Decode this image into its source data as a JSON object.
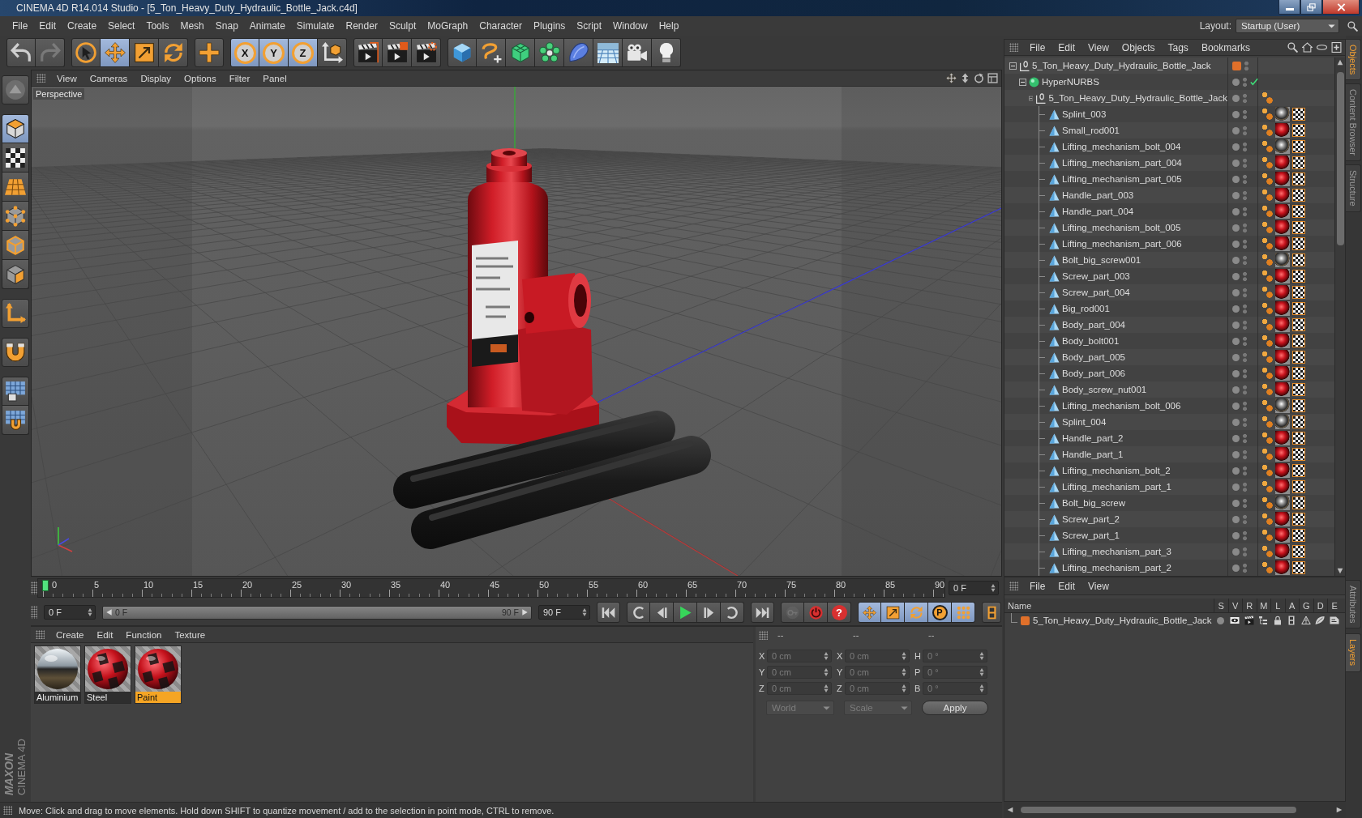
{
  "window": {
    "title": "CINEMA 4D R14.014 Studio - [5_Ton_Heavy_Duty_Hydraulic_Bottle_Jack.c4d]"
  },
  "menu": [
    "File",
    "Edit",
    "Create",
    "Select",
    "Tools",
    "Mesh",
    "Snap",
    "Animate",
    "Simulate",
    "Render",
    "Sculpt",
    "MoGraph",
    "Character",
    "Plugins",
    "Script",
    "Window",
    "Help"
  ],
  "layout": {
    "label": "Layout:",
    "value": "Startup (User)"
  },
  "toolbar": [
    {
      "tools": [
        {
          "kind": "undo",
          "disabled": false
        },
        {
          "kind": "redo",
          "disabled": true
        }
      ]
    },
    {
      "tools": [
        {
          "kind": "select",
          "selected": false
        },
        {
          "kind": "move",
          "selected": true
        },
        {
          "kind": "scale",
          "selected": false
        },
        {
          "kind": "rotate",
          "selected": false
        }
      ]
    },
    {
      "tools": [
        {
          "kind": "add",
          "selected": false
        }
      ]
    },
    {
      "tools": [
        {
          "kind": "axis",
          "label": "X",
          "selected": true
        },
        {
          "kind": "axis",
          "label": "Y",
          "selected": true
        },
        {
          "kind": "axis",
          "label": "Z",
          "selected": true
        },
        {
          "kind": "coords",
          "selected": false
        }
      ]
    },
    {
      "tools": [
        {
          "kind": "render-view"
        },
        {
          "kind": "render-picture"
        },
        {
          "kind": "render-settings"
        }
      ]
    },
    {
      "tools": [
        {
          "kind": "cube"
        },
        {
          "kind": "spline"
        },
        {
          "kind": "nurbs"
        },
        {
          "kind": "array"
        },
        {
          "kind": "deformer"
        },
        {
          "kind": "floor"
        },
        {
          "kind": "camera"
        },
        {
          "kind": "light"
        }
      ]
    }
  ],
  "mode_bar": [
    {
      "tools": [
        {
          "kind": "make-editable",
          "selected": false
        }
      ]
    },
    {
      "tools": [
        {
          "kind": "model",
          "selected": true
        },
        {
          "kind": "texture",
          "selected": false
        },
        {
          "kind": "workplane",
          "selected": false
        },
        {
          "kind": "points",
          "selected": false
        },
        {
          "kind": "edges",
          "selected": false
        },
        {
          "kind": "polygons",
          "selected": false
        }
      ]
    },
    {
      "tools": [
        {
          "kind": "axis",
          "selected": false
        }
      ]
    },
    {
      "tools": [
        {
          "kind": "tweak",
          "selected": false
        }
      ]
    },
    {
      "tools": [
        {
          "kind": "snap-grid",
          "selected": false
        },
        {
          "kind": "snap",
          "selected": false
        }
      ]
    }
  ],
  "logo": {
    "brand": "MAXON",
    "product": "CINEMA 4D"
  },
  "viewport": {
    "menu": [
      "View",
      "Cameras",
      "Display",
      "Options",
      "Filter",
      "Panel"
    ],
    "camera": "Perspective"
  },
  "timeline": {
    "ticks": [
      "0",
      "5",
      "10",
      "15",
      "20",
      "25",
      "30",
      "35",
      "40",
      "45",
      "50",
      "55",
      "60",
      "65",
      "70",
      "75",
      "80",
      "85",
      "90"
    ],
    "playhead": {
      "level": 0
    },
    "current": "0 F"
  },
  "transport": {
    "start": "0 F",
    "range_start": "0 F",
    "range_end": "90 F",
    "end": "90 F",
    "playback": [
      {
        "buttons": [
          {
            "kind": "skip-start"
          }
        ]
      },
      {
        "buttons": [
          {
            "kind": "prev-key"
          },
          {
            "kind": "step-back"
          },
          {
            "kind": "play"
          },
          {
            "kind": "step-forward"
          },
          {
            "kind": "next-key"
          }
        ]
      },
      {
        "buttons": [
          {
            "kind": "skip-end"
          }
        ]
      }
    ],
    "record": [
      {
        "kind": "key",
        "disabled": true
      },
      {
        "kind": "record",
        "disabled": false
      },
      {
        "kind": "selection",
        "label": "?",
        "disabled": false
      }
    ],
    "keys": [
      {
        "kind": "move",
        "selected": true
      },
      {
        "kind": "scale",
        "selected": true
      },
      {
        "kind": "rotate",
        "selected": true
      },
      {
        "kind": "param",
        "label": "P",
        "selected": true
      },
      {
        "kind": "grid",
        "selected": true
      }
    ]
  },
  "materials": {
    "menu": [
      "Create",
      "Edit",
      "Function",
      "Texture"
    ],
    "items": [
      {
        "name": "Aluminium",
        "kind": "chrome",
        "selected": false
      },
      {
        "name": "Steel",
        "kind": "checker",
        "selected": false
      },
      {
        "name": "Paint",
        "kind": "checker",
        "selected": true
      }
    ]
  },
  "coordinates": {
    "headers": [
      "--",
      "--",
      "--"
    ],
    "disabled": true,
    "rows": [
      {
        "position_axis": "X",
        "position": "0 cm",
        "size_axis": "X",
        "size": "0 cm",
        "rotation_axis": "H",
        "rotation": "0 °"
      },
      {
        "position_axis": "Y",
        "position": "0 cm",
        "size_axis": "Y",
        "size": "0 cm",
        "rotation_axis": "P",
        "rotation": "0 °"
      },
      {
        "position_axis": "Z",
        "position": "0 cm",
        "size_axis": "Z",
        "size": "0 cm",
        "rotation_axis": "B",
        "rotation": "0 °"
      }
    ],
    "mode": "World",
    "size_mode": "Scale",
    "apply": "Apply"
  },
  "object_manager": {
    "menu": [
      "File",
      "Edit",
      "View",
      "Objects",
      "Tags",
      "Bookmarks"
    ],
    "objects": [
      {
        "name": "5_Ton_Heavy_Duty_Hydraulic_Bottle_Jack",
        "kind": "null",
        "expanded": true,
        "layer": true,
        "children": [
          {
            "name": "HyperNURBS",
            "kind": "hypernurbs",
            "expanded": true,
            "layer": false,
            "enabled": true,
            "children": [
              {
                "name": "5_Ton_Heavy_Duty_Hydraulic_Bottle_Jack",
                "kind": "null",
                "expanded": true,
                "layer": false,
                "tags": [
                  {
                    "kind": "phong"
                  }
                ],
                "children": [
                  {
                    "name": "Splint_003",
                    "kind": "polygon",
                    "layer": false,
                    "tags": [
                      {
                        "kind": "phong"
                      },
                      {
                        "kind": "chrome"
                      },
                      {
                        "kind": "texture"
                      }
                    ]
                  },
                  {
                    "name": "Small_rod001",
                    "kind": "polygon",
                    "layer": false,
                    "tags": [
                      {
                        "kind": "phong"
                      },
                      {
                        "kind": "checker"
                      },
                      {
                        "kind": "texture"
                      }
                    ]
                  },
                  {
                    "name": "Lifting_mechanism_bolt_004",
                    "kind": "polygon",
                    "layer": false,
                    "tags": [
                      {
                        "kind": "phong"
                      },
                      {
                        "kind": "chrome"
                      },
                      {
                        "kind": "texture"
                      }
                    ]
                  },
                  {
                    "name": "Lifting_mechanism_part_004",
                    "kind": "polygon",
                    "layer": false,
                    "tags": [
                      {
                        "kind": "phong"
                      },
                      {
                        "kind": "checker"
                      },
                      {
                        "kind": "texture"
                      }
                    ]
                  },
                  {
                    "name": "Lifting_mechanism_part_005",
                    "kind": "polygon",
                    "layer": false,
                    "tags": [
                      {
                        "kind": "phong"
                      },
                      {
                        "kind": "checker"
                      },
                      {
                        "kind": "texture"
                      }
                    ]
                  },
                  {
                    "name": "Handle_part_003",
                    "kind": "polygon",
                    "layer": false,
                    "tags": [
                      {
                        "kind": "phong"
                      },
                      {
                        "kind": "checker"
                      },
                      {
                        "kind": "texture"
                      }
                    ]
                  },
                  {
                    "name": "Handle_part_004",
                    "kind": "polygon",
                    "layer": false,
                    "tags": [
                      {
                        "kind": "phong"
                      },
                      {
                        "kind": "checker"
                      },
                      {
                        "kind": "texture"
                      }
                    ]
                  },
                  {
                    "name": "Lifting_mechanism_bolt_005",
                    "kind": "polygon",
                    "layer": false,
                    "tags": [
                      {
                        "kind": "phong"
                      },
                      {
                        "kind": "checker"
                      },
                      {
                        "kind": "texture"
                      }
                    ]
                  },
                  {
                    "name": "Lifting_mechanism_part_006",
                    "kind": "polygon",
                    "layer": false,
                    "tags": [
                      {
                        "kind": "phong"
                      },
                      {
                        "kind": "checker"
                      },
                      {
                        "kind": "texture"
                      }
                    ]
                  },
                  {
                    "name": "Bolt_big_screw001",
                    "kind": "polygon",
                    "layer": false,
                    "tags": [
                      {
                        "kind": "phong"
                      },
                      {
                        "kind": "chrome"
                      },
                      {
                        "kind": "texture"
                      }
                    ]
                  },
                  {
                    "name": "Screw_part_003",
                    "kind": "polygon",
                    "layer": false,
                    "tags": [
                      {
                        "kind": "phong"
                      },
                      {
                        "kind": "checker"
                      },
                      {
                        "kind": "texture"
                      }
                    ]
                  },
                  {
                    "name": "Screw_part_004",
                    "kind": "polygon",
                    "layer": false,
                    "tags": [
                      {
                        "kind": "phong"
                      },
                      {
                        "kind": "checker"
                      },
                      {
                        "kind": "texture"
                      }
                    ]
                  },
                  {
                    "name": "Big_rod001",
                    "kind": "polygon",
                    "layer": false,
                    "tags": [
                      {
                        "kind": "phong"
                      },
                      {
                        "kind": "checker"
                      },
                      {
                        "kind": "texture"
                      }
                    ]
                  },
                  {
                    "name": "Body_part_004",
                    "kind": "polygon",
                    "layer": false,
                    "tags": [
                      {
                        "kind": "phong"
                      },
                      {
                        "kind": "checker"
                      },
                      {
                        "kind": "texture"
                      }
                    ]
                  },
                  {
                    "name": "Body_bolt001",
                    "kind": "polygon",
                    "layer": false,
                    "tags": [
                      {
                        "kind": "phong"
                      },
                      {
                        "kind": "checker"
                      },
                      {
                        "kind": "texture"
                      }
                    ]
                  },
                  {
                    "name": "Body_part_005",
                    "kind": "polygon",
                    "layer": false,
                    "tags": [
                      {
                        "kind": "phong"
                      },
                      {
                        "kind": "checker"
                      },
                      {
                        "kind": "texture"
                      }
                    ]
                  },
                  {
                    "name": "Body_part_006",
                    "kind": "polygon",
                    "layer": false,
                    "tags": [
                      {
                        "kind": "phong"
                      },
                      {
                        "kind": "checker"
                      },
                      {
                        "kind": "texture"
                      }
                    ]
                  },
                  {
                    "name": "Body_screw_nut001",
                    "kind": "polygon",
                    "layer": false,
                    "tags": [
                      {
                        "kind": "phong"
                      },
                      {
                        "kind": "checker"
                      },
                      {
                        "kind": "texture"
                      }
                    ]
                  },
                  {
                    "name": "Lifting_mechanism_bolt_006",
                    "kind": "polygon",
                    "layer": false,
                    "tags": [
                      {
                        "kind": "phong"
                      },
                      {
                        "kind": "chrome"
                      },
                      {
                        "kind": "texture"
                      }
                    ]
                  },
                  {
                    "name": "Splint_004",
                    "kind": "polygon",
                    "layer": false,
                    "tags": [
                      {
                        "kind": "phong"
                      },
                      {
                        "kind": "chrome"
                      },
                      {
                        "kind": "texture"
                      }
                    ]
                  },
                  {
                    "name": "Handle_part_2",
                    "kind": "polygon",
                    "layer": false,
                    "tags": [
                      {
                        "kind": "phong"
                      },
                      {
                        "kind": "checker"
                      },
                      {
                        "kind": "texture"
                      }
                    ]
                  },
                  {
                    "name": "Handle_part_1",
                    "kind": "polygon",
                    "layer": false,
                    "tags": [
                      {
                        "kind": "phong"
                      },
                      {
                        "kind": "checker"
                      },
                      {
                        "kind": "texture"
                      }
                    ]
                  },
                  {
                    "name": "Lifting_mechanism_bolt_2",
                    "kind": "polygon",
                    "layer": false,
                    "tags": [
                      {
                        "kind": "phong"
                      },
                      {
                        "kind": "checker"
                      },
                      {
                        "kind": "texture"
                      }
                    ]
                  },
                  {
                    "name": "Lifting_mechanism_part_1",
                    "kind": "polygon",
                    "layer": false,
                    "tags": [
                      {
                        "kind": "phong"
                      },
                      {
                        "kind": "checker"
                      },
                      {
                        "kind": "texture"
                      }
                    ]
                  },
                  {
                    "name": "Bolt_big_screw",
                    "kind": "polygon",
                    "layer": false,
                    "tags": [
                      {
                        "kind": "phong"
                      },
                      {
                        "kind": "chrome"
                      },
                      {
                        "kind": "texture"
                      }
                    ]
                  },
                  {
                    "name": "Screw_part_2",
                    "kind": "polygon",
                    "layer": false,
                    "tags": [
                      {
                        "kind": "phong"
                      },
                      {
                        "kind": "checker"
                      },
                      {
                        "kind": "texture"
                      }
                    ]
                  },
                  {
                    "name": "Screw_part_1",
                    "kind": "polygon",
                    "layer": false,
                    "tags": [
                      {
                        "kind": "phong"
                      },
                      {
                        "kind": "checker"
                      },
                      {
                        "kind": "texture"
                      }
                    ]
                  },
                  {
                    "name": "Lifting_mechanism_part_3",
                    "kind": "polygon",
                    "layer": false,
                    "tags": [
                      {
                        "kind": "phong"
                      },
                      {
                        "kind": "checker"
                      },
                      {
                        "kind": "texture"
                      }
                    ]
                  },
                  {
                    "name": "Lifting_mechanism_part_2",
                    "kind": "polygon",
                    "layer": false,
                    "tags": [
                      {
                        "kind": "phong"
                      },
                      {
                        "kind": "checker"
                      },
                      {
                        "kind": "texture"
                      }
                    ]
                  }
                ]
              }
            ]
          }
        ]
      }
    ]
  },
  "side_tabs": {
    "top": [
      {
        "label": "Objects",
        "selected": true
      },
      {
        "label": "Content Browser",
        "selected": false
      },
      {
        "label": "Structure",
        "selected": false
      }
    ],
    "bottom": [
      {
        "label": "Attributes",
        "selected": false
      },
      {
        "label": "Layers",
        "selected": true
      }
    ]
  },
  "layers": {
    "menu": [
      "File",
      "Edit",
      "View"
    ],
    "columns": [
      "Name",
      "S",
      "V",
      "R",
      "M",
      "L",
      "A",
      "G",
      "D",
      "E"
    ],
    "items": [
      {
        "name": "5_Ton_Heavy_Duty_Hydraulic_Bottle_Jack",
        "color": "#e0702a",
        "solo": false
      }
    ]
  },
  "status": "Move: Click and drag to move elements. Hold down SHIFT to quantize movement / add to the selection in point mode, CTRL to remove."
}
